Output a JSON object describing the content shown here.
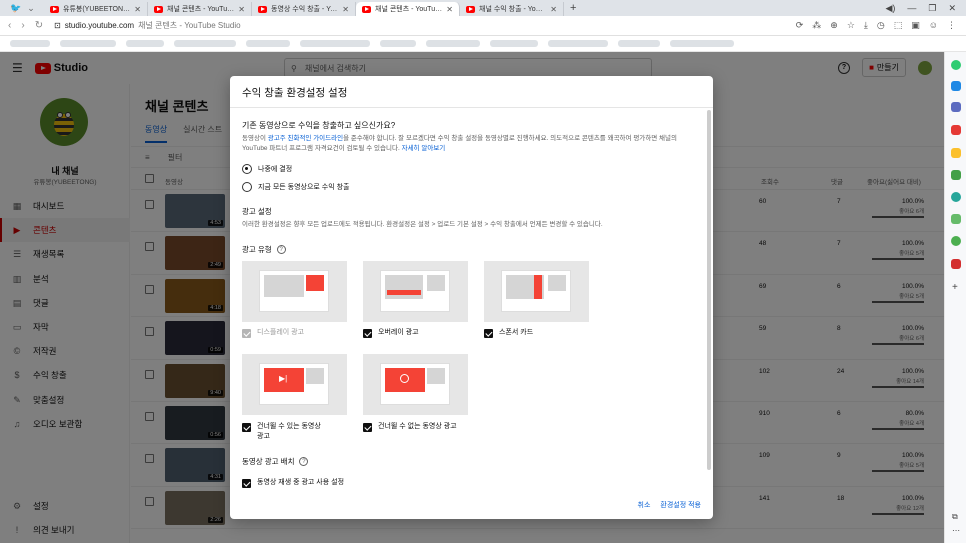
{
  "browser": {
    "tabs": [
      {
        "label": "유튜봉(YUBEETONG) - YouTube",
        "active": false
      },
      {
        "label": "채널 콘텐츠 - YouTube Studio",
        "active": false
      },
      {
        "label": "동영상 수익 창출 - YouTube St...",
        "active": false
      },
      {
        "label": "채널 콘텐츠 - YouTube Studio",
        "active": true
      },
      {
        "label": "채널 수익 창출 - YouTube Studio",
        "active": false
      }
    ],
    "url_host": "studio.youtube.com",
    "url_title": "채널 콘텐츠 - YouTube Studio"
  },
  "app": {
    "logo_text": "Studio",
    "search_placeholder": "채널에서 검색하기",
    "create_label": "만들기"
  },
  "channel": {
    "name": "내 채널",
    "handle": "유튜봉(YUBEETONG)"
  },
  "sidebar": {
    "items": [
      {
        "label": "대시보드",
        "icon": "dashboard-icon",
        "glyph": "▦"
      },
      {
        "label": "콘텐츠",
        "icon": "content-icon",
        "glyph": "▶",
        "active": true
      },
      {
        "label": "재생목록",
        "icon": "playlist-icon",
        "glyph": "☰"
      },
      {
        "label": "분석",
        "icon": "analytics-icon",
        "glyph": "▥"
      },
      {
        "label": "댓글",
        "icon": "comments-icon",
        "glyph": "▤"
      },
      {
        "label": "자막",
        "icon": "subtitles-icon",
        "glyph": "▭"
      },
      {
        "label": "저작권",
        "icon": "copyright-icon",
        "glyph": "©"
      },
      {
        "label": "수익 창출",
        "icon": "monetization-icon",
        "glyph": "$"
      },
      {
        "label": "맞춤설정",
        "icon": "customization-icon",
        "glyph": "✎"
      },
      {
        "label": "오디오 보관함",
        "icon": "audio-library-icon",
        "glyph": "♫"
      }
    ],
    "bottom": [
      {
        "label": "설정",
        "icon": "settings-icon",
        "glyph": "⚙"
      },
      {
        "label": "의견 보내기",
        "icon": "feedback-icon",
        "glyph": "!"
      }
    ]
  },
  "content": {
    "title": "채널 콘텐츠",
    "tabs": [
      {
        "label": "동영상",
        "active": true
      },
      {
        "label": "실시간 스트",
        "active": false
      }
    ],
    "filter_label": "필터",
    "columns": {
      "video": "동영상",
      "views": "조회수",
      "comments": "댓글",
      "likes": "좋아요(싫어요 대비)"
    },
    "rows": [
      {
        "duration": "4:53",
        "views": "60",
        "comments": "7",
        "likes_pct": "100.0%",
        "likes_sub": "좋아요 6개",
        "thumb_color": "#5a6a7a"
      },
      {
        "duration": "2:49",
        "views": "48",
        "comments": "7",
        "likes_pct": "100.0%",
        "likes_sub": "좋아요 5개",
        "thumb_color": "#7a4a2a"
      },
      {
        "duration": "4:18",
        "views": "69",
        "comments": "6",
        "likes_pct": "100.0%",
        "likes_sub": "좋아요 5개",
        "thumb_color": "#8a5a1a"
      },
      {
        "duration": "0:59",
        "views": "59",
        "comments": "8",
        "likes_pct": "100.0%",
        "likes_sub": "좋아요 6개",
        "thumb_color": "#2a2a3a"
      },
      {
        "duration": "9:40",
        "views": "102",
        "comments": "24",
        "likes_pct": "100.0%",
        "likes_sub": "좋아요 14개",
        "thumb_color": "#6a5030"
      },
      {
        "duration": "0:56",
        "views": "910",
        "comments": "6",
        "likes_pct": "80.0%",
        "likes_sub": "좋아요 4개",
        "thumb_color": "#303840"
      },
      {
        "duration": "4:31",
        "views": "109",
        "comments": "9",
        "likes_pct": "100.0%",
        "likes_sub": "좋아요 5개",
        "thumb_color": "#506070"
      },
      {
        "duration": "2:26",
        "views": "141",
        "comments": "18",
        "likes_pct": "100.0%",
        "likes_sub": "좋아요 12개",
        "thumb_color": "#7a7060"
      }
    ]
  },
  "modal": {
    "title": "수익 창출 환경설정 설정",
    "question": "기존 동영상으로 수익을 창출하고 싶으신가요?",
    "question_desc_1": "동영상이 ",
    "question_desc_link": "광고주 친화적인 가이드라인",
    "question_desc_2": "을 준수해야 합니다. 잘 모르겠다면 수익 창출 설정을 동영상별로 진행하세요. 의도적으로 콘텐츠를 왜곡하여 평가하면 채널의 YouTube 파트너 프로그램 자격요건이 검토될 수 있습니다. ",
    "question_desc_more": "자세히 알아보기",
    "radio_later": "나중에 결정",
    "radio_now": "지금 모든 동영상으로 수익 창출",
    "ad_settings_title": "광고 설정",
    "ad_settings_desc": "이러한 환경설정은 향후 모든 업로드에도 적용됩니다. 환경설정은 설정 > 업로드 기본 설정 > 수익 창출에서 언제든 변경할 수 있습니다.",
    "ad_type_title": "광고 유형",
    "ad_types": [
      {
        "label": "디스플레이 광고",
        "checked": true,
        "disabled": true
      },
      {
        "label": "오버레이 광고",
        "checked": true,
        "disabled": false
      },
      {
        "label": "스폰서 카드",
        "checked": true,
        "disabled": false
      },
      {
        "label": "건너뛸 수 있는 동영상 광고",
        "checked": true,
        "disabled": false
      },
      {
        "label": "건너뛸 수 없는 동영상 광고",
        "checked": true,
        "disabled": false
      }
    ],
    "placement_title": "동영상 광고 배치",
    "placement_option": "동영상 재생 중 광고 사용 설정",
    "cancel": "취소",
    "apply": "환경설정 적용",
    "accent": "#065fd4",
    "ad_red": "#f44336"
  }
}
